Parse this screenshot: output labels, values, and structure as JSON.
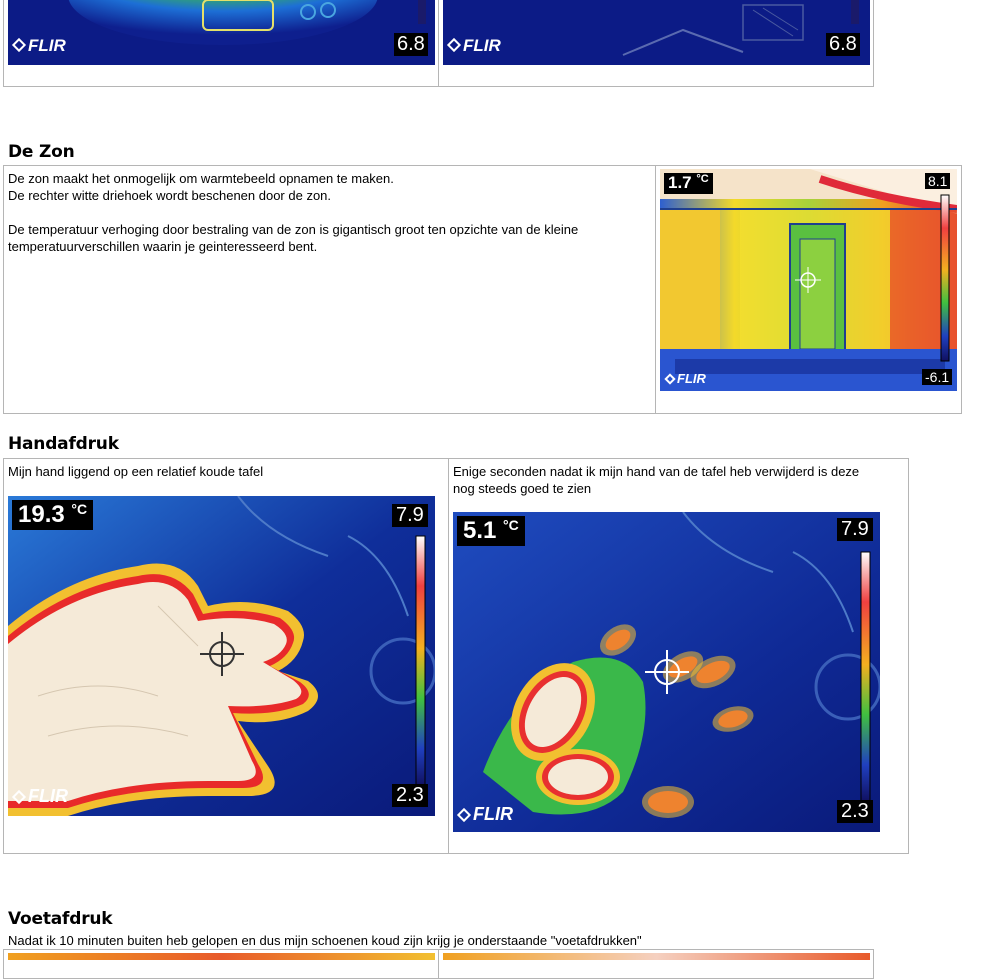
{
  "top_section": {
    "images": [
      {
        "brand": "FLIR",
        "scale_min": "6.8"
      },
      {
        "brand": "FLIR",
        "scale_min": "6.8"
      }
    ]
  },
  "zon": {
    "heading": "De Zon",
    "paragraph1_line1": "De zon maakt het onmogelijk om warmtebeeld opnamen te maken.",
    "paragraph1_line2": "De rechter witte driehoek wordt beschenen door de zon.",
    "paragraph2_line1": "De temperatuur verhoging door bestraling van de zon is gigantisch  groot ten opzichte van de kleine",
    "paragraph2_line2": "temperatuurverschillen waarin  je geinteresseerd bent.",
    "image": {
      "spot_temp": "1.7",
      "unit": "°C",
      "scale_max": "8.1",
      "scale_min": "-6.1",
      "brand": "FLIR"
    }
  },
  "hand": {
    "heading": "Handafdruk",
    "left_caption": "Mijn hand liggend op een relatief koude tafel",
    "right_caption_line1": "Enige seconden nadat ik mijn hand van de tafel heb verwijderd is  deze",
    "right_caption_line2": "nog steeds goed te zien",
    "left_image": {
      "spot_temp": "19.3",
      "unit": "°C",
      "scale_max": "7.9",
      "scale_min": "2.3",
      "brand": "FLIR"
    },
    "right_image": {
      "spot_temp": "5.1",
      "unit": "°C",
      "scale_max": "7.9",
      "scale_min": "2.3",
      "brand": "FLIR"
    }
  },
  "voet": {
    "heading": "Voetafdruk",
    "caption": "Nadat ik 10  minuten buiten heb gelopen en dus mijn schoenen koud zijn krijg je onderstaande \"voetafdrukken\""
  }
}
